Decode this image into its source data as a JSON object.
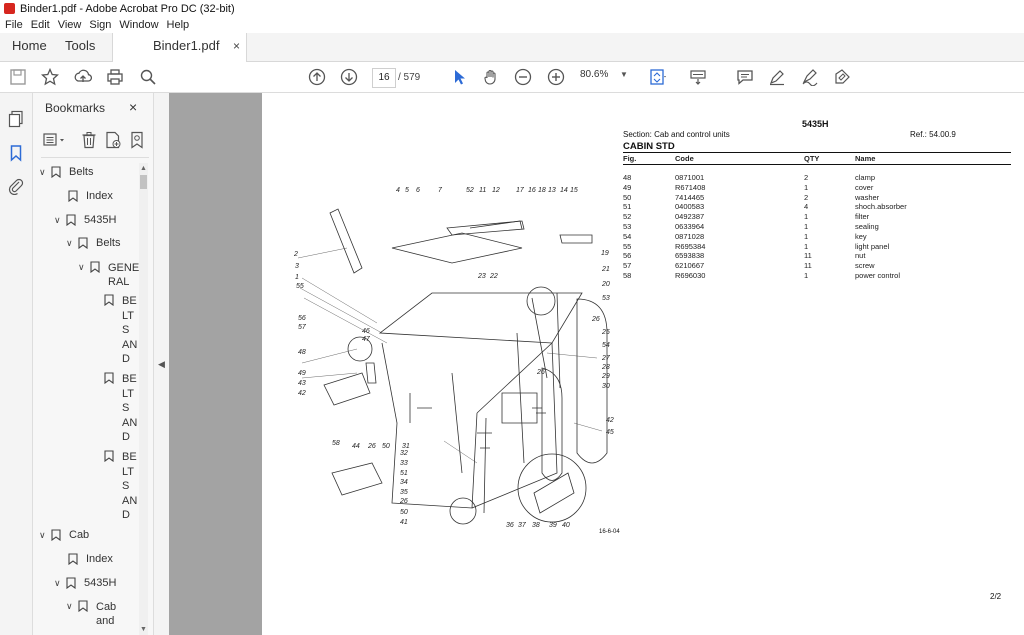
{
  "window": {
    "title": "Binder1.pdf - Adobe Acrobat Pro DC (32-bit)"
  },
  "menu": [
    "File",
    "Edit",
    "View",
    "Sign",
    "Window",
    "Help"
  ],
  "tabs": {
    "home": "Home",
    "tools": "Tools",
    "document": "Binder1.pdf",
    "close": "×"
  },
  "toolbar": {
    "current_page": "16",
    "total_pages": "/  579",
    "zoom": "80.6%"
  },
  "bookmarks": {
    "title": "Bookmarks",
    "close": "×",
    "items": [
      {
        "label": "Belts",
        "level": 0,
        "expanded": true
      },
      {
        "label": "Index",
        "level": 1,
        "expanded": null
      },
      {
        "label": "5435H",
        "level": 1,
        "expanded": true
      },
      {
        "label": "Belts",
        "level": 2,
        "expanded": true
      },
      {
        "label": "GENE RAL",
        "level": 3,
        "expanded": true
      },
      {
        "label": "BE LT S AN D",
        "level": 4,
        "expanded": null
      },
      {
        "label": "BE LT S AN D",
        "level": 4,
        "expanded": null
      },
      {
        "label": "BE LT S AN D",
        "level": 4,
        "expanded": null
      },
      {
        "label": "Cab",
        "level": 0,
        "expanded": true
      },
      {
        "label": "Index",
        "level": 1,
        "expanded": null
      },
      {
        "label": "5435H",
        "level": 1,
        "expanded": true
      },
      {
        "label": "Cab and",
        "level": 2,
        "expanded": true
      }
    ]
  },
  "pdf": {
    "model": "5435H",
    "section": "Section: Cab and control units",
    "ref": "Ref.: 54.00.9",
    "heading": "CABIN STD",
    "columns": {
      "fig": "Fig.",
      "code": "Code",
      "qty": "QTY",
      "name": "Name"
    },
    "rows": [
      {
        "fig": "48",
        "code": "0871001",
        "qty": "2",
        "name": "clamp"
      },
      {
        "fig": "49",
        "code": "R671408",
        "qty": "1",
        "name": "cover"
      },
      {
        "fig": "50",
        "code": "7414465",
        "qty": "2",
        "name": "washer"
      },
      {
        "fig": "51",
        "code": "0400583",
        "qty": "4",
        "name": "shoch.absorber"
      },
      {
        "fig": "52",
        "code": "0492387",
        "qty": "1",
        "name": "filter"
      },
      {
        "fig": "53",
        "code": "0633964",
        "qty": "1",
        "name": "sealing"
      },
      {
        "fig": "54",
        "code": "0871028",
        "qty": "1",
        "name": "key"
      },
      {
        "fig": "55",
        "code": "R695384",
        "qty": "1",
        "name": "light panel"
      },
      {
        "fig": "56",
        "code": "6593838",
        "qty": "11",
        "name": "nut"
      },
      {
        "fig": "57",
        "code": "6210667",
        "qty": "11",
        "name": "screw"
      },
      {
        "fig": "58",
        "code": "R696030",
        "qty": "1",
        "name": "power control"
      }
    ],
    "drawing_code": "16-6-04",
    "page_label": "2/2",
    "callouts": [
      "4",
      "5",
      "6",
      "7",
      "52",
      "11",
      "12",
      "17",
      "16",
      "18",
      "13",
      "14",
      "15",
      "2",
      "3",
      "1",
      "55",
      "19",
      "21",
      "23",
      "22",
      "20",
      "53",
      "56",
      "57",
      "26",
      "46",
      "47",
      "25",
      "54",
      "48",
      "27",
      "28",
      "26",
      "29",
      "30",
      "49",
      "43",
      "42",
      "42",
      "45",
      "58",
      "44",
      "26",
      "50",
      "31",
      "32",
      "33",
      "51",
      "34",
      "35",
      "26",
      "50",
      "41",
      "36",
      "37",
      "38",
      "39",
      "40"
    ]
  }
}
